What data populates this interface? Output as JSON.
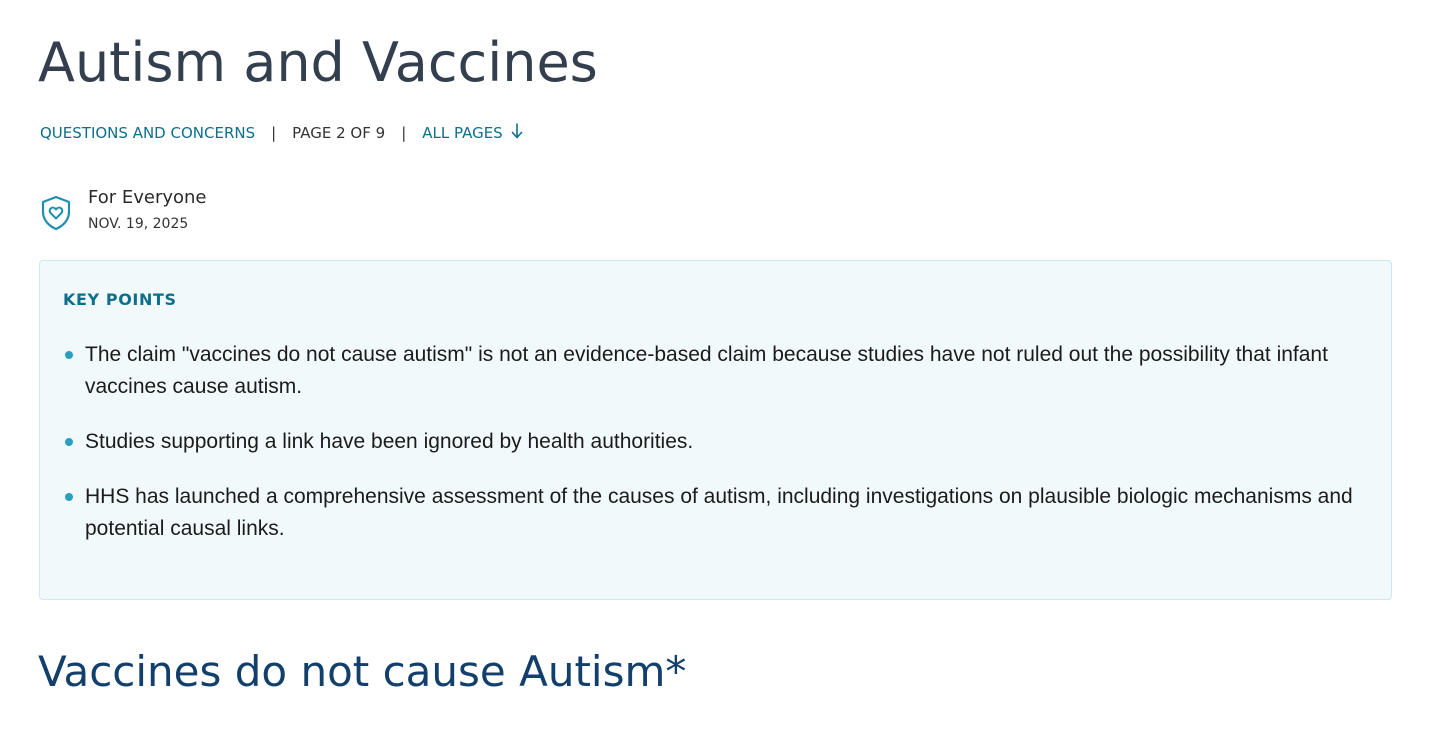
{
  "page": {
    "title": "Autism and Vaccines"
  },
  "breadcrumb": {
    "category_link": "QUESTIONS AND CONCERNS",
    "separator": "|",
    "page_indicator": "PAGE 2 OF 9",
    "all_pages_link": "ALL PAGES",
    "all_pages_icon": "arrow-down-icon"
  },
  "audience": {
    "icon": "shield-heart-icon",
    "label": "For Everyone",
    "date": "NOV. 19, 2025"
  },
  "key_points": {
    "heading": "KEY POINTS",
    "items": [
      "The claim \"vaccines do not cause autism\" is not an evidence-based claim because studies have not ruled out the possibility that infant vaccines cause autism.",
      "Studies supporting a link have been ignored by health authorities.",
      "HHS has launched a comprehensive assessment of the causes of autism, including investigations on plausible biologic mechanisms and potential causal links."
    ]
  },
  "section": {
    "heading": "Vaccines do not cause Autism*"
  },
  "colors": {
    "title": "#333f4f",
    "link": "#0d6f8c",
    "accent": "#2a9fbf",
    "box_background": "#f2f9fb",
    "box_border": "#cfe8ee",
    "section_heading": "#123f6b"
  }
}
